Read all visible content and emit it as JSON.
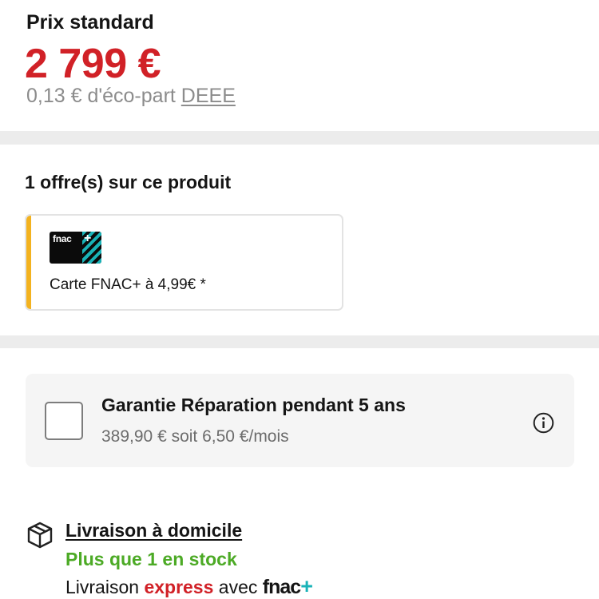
{
  "price": {
    "label": "Prix standard",
    "value": "2 799 €",
    "eco_prefix": "0,13 € d'éco-part ",
    "eco_link": "DEEE",
    "value_color": "#d12127"
  },
  "offers": {
    "title": "1 offre(s) sur ce produit",
    "card": {
      "logo_text": "fnac",
      "logo_plus": "+",
      "text": "Carte FNAC+ à 4,99€ *",
      "accent_color": "#f3b21f"
    }
  },
  "warranty": {
    "title": "Garantie Réparation pendant 5 ans",
    "price": "389,90 € soit 6,50 €/mois",
    "checked": false,
    "info_icon": "info-circle-icon"
  },
  "delivery": {
    "icon": "package-box-icon",
    "link_label": "Livraison à domicile",
    "stock_text": "Plus que 1 en stock",
    "stock_color": "#4caa25",
    "express_prefix": "Livraison ",
    "express_word": "express",
    "express_suffix": " avec ",
    "logo_text": "fnac",
    "logo_plus": "+"
  }
}
